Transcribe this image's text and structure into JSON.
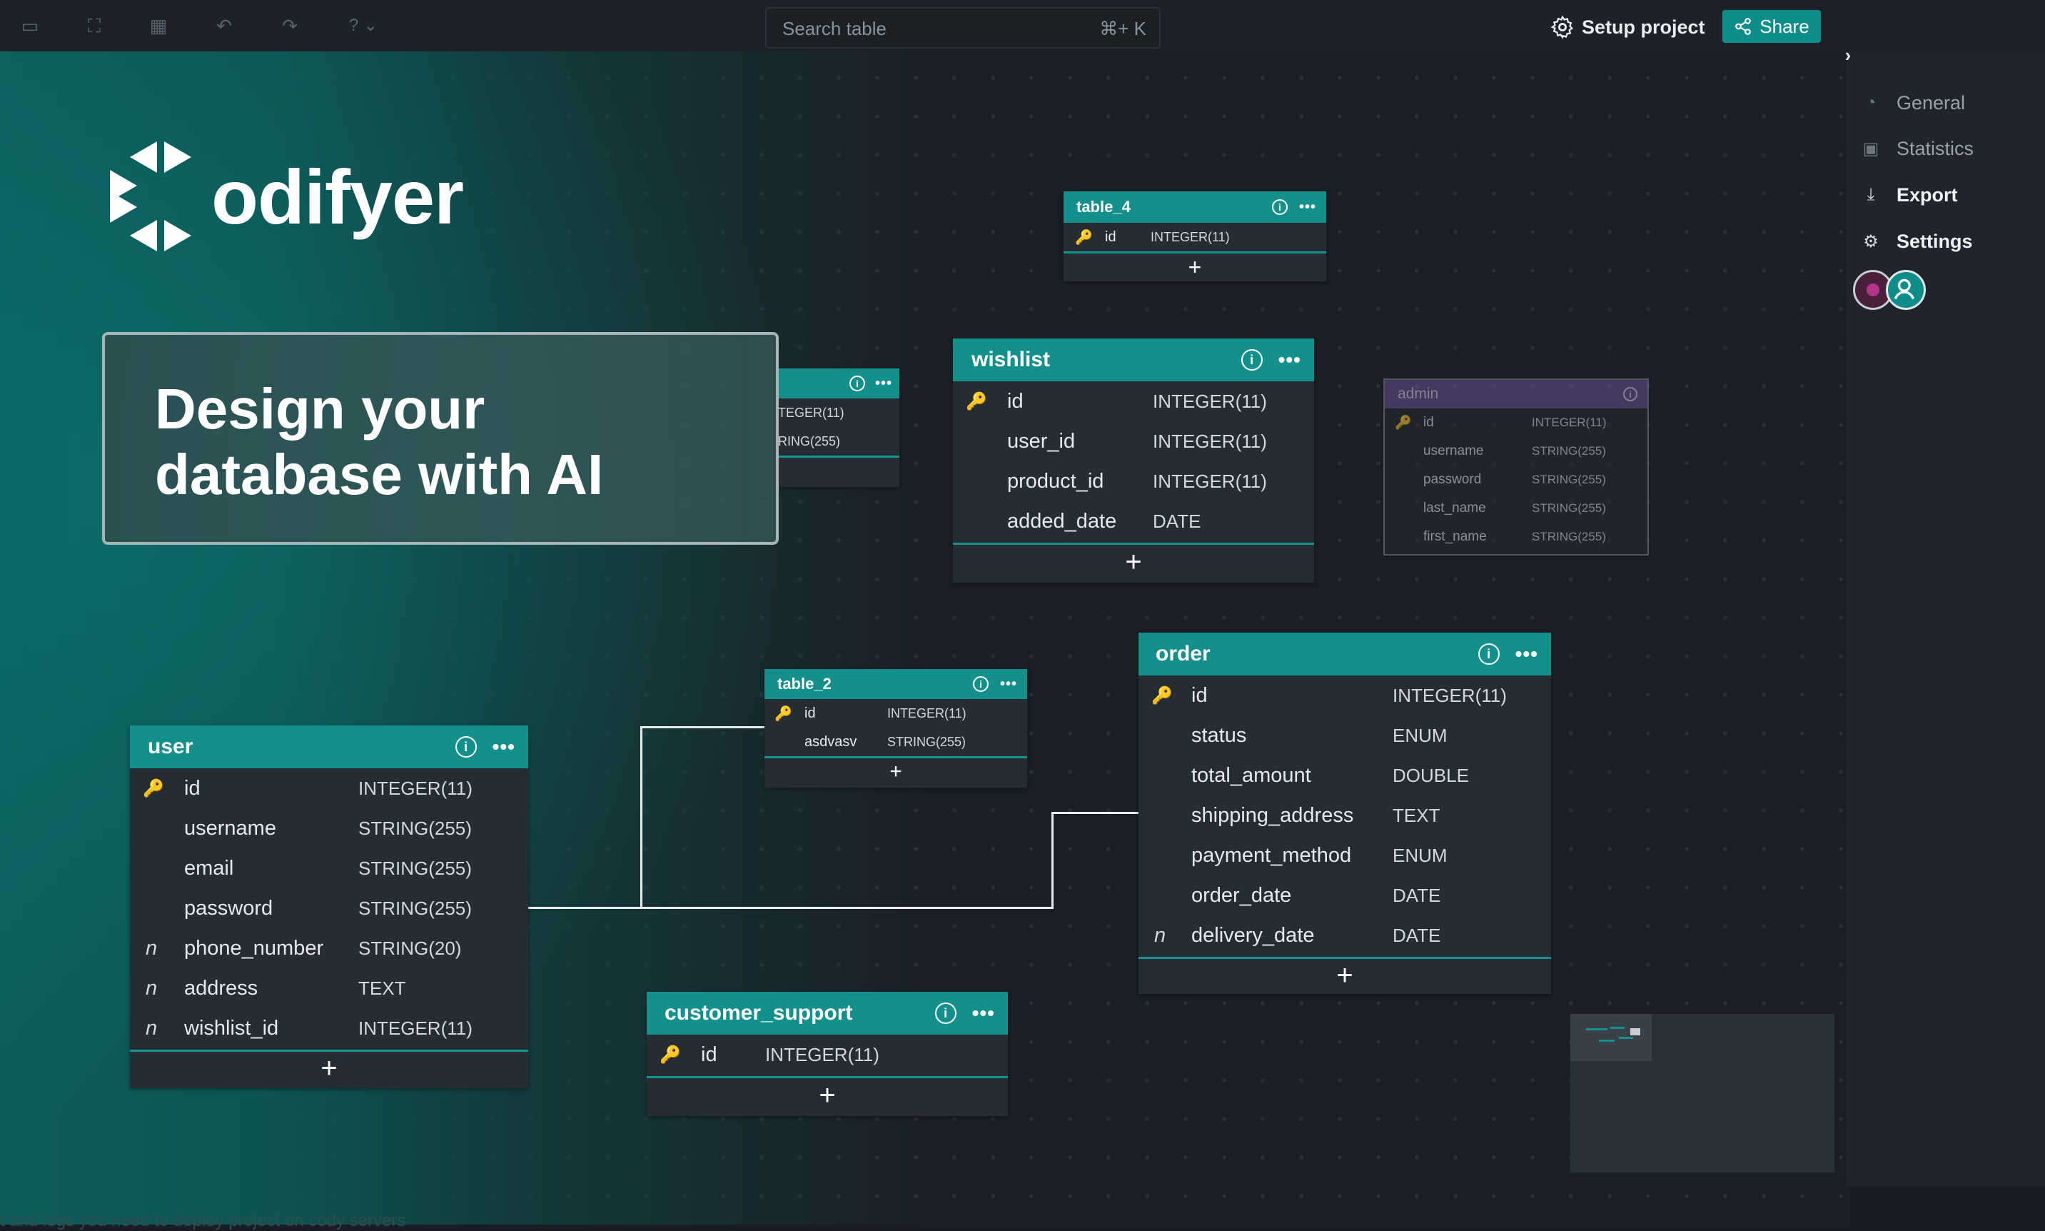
{
  "toolbar": {
    "search_placeholder": "Search table",
    "search_shortcut": "⌘+ K",
    "help_label": "?",
    "setup_label": "Setup project",
    "share_label": "Share"
  },
  "sidebar": {
    "items": [
      {
        "label": "General",
        "icon": "gauge-icon"
      },
      {
        "label": "Statistics",
        "icon": "chart-icon"
      },
      {
        "label": "Export",
        "icon": "download-icon"
      },
      {
        "label": "Settings",
        "icon": "gear-icon"
      }
    ]
  },
  "brand": {
    "logo_text": "odifyer"
  },
  "hero": {
    "line1": "Design your",
    "line2": "database with AI"
  },
  "tables": {
    "table_4": {
      "name": "table_4",
      "cols": [
        {
          "name": "id",
          "type": "INTEGER(11)"
        }
      ]
    },
    "partial": {
      "cols": [
        {
          "type": "TEGER(11)"
        },
        {
          "type": "RING(255)"
        }
      ]
    },
    "wishlist": {
      "name": "wishlist",
      "cols": [
        {
          "name": "id",
          "type": "INTEGER(11)"
        },
        {
          "name": "user_id",
          "type": "INTEGER(11)"
        },
        {
          "name": "product_id",
          "type": "INTEGER(11)"
        },
        {
          "name": "added_date",
          "type": "DATE"
        }
      ]
    },
    "admin": {
      "name": "admin",
      "cols": [
        {
          "name": "id",
          "type": "INTEGER(11)"
        },
        {
          "name": "username",
          "type": "STRING(255)"
        },
        {
          "name": "password",
          "type": "STRING(255)"
        },
        {
          "name": "last_name",
          "type": "STRING(255)"
        },
        {
          "name": "first_name",
          "type": "STRING(255)"
        }
      ]
    },
    "table_2": {
      "name": "table_2",
      "cols": [
        {
          "name": "id",
          "type": "INTEGER(11)"
        },
        {
          "name": "asdvasv",
          "type": "STRING(255)"
        }
      ]
    },
    "order": {
      "name": "order",
      "cols": [
        {
          "name": "id",
          "type": "INTEGER(11)"
        },
        {
          "name": "status",
          "type": "ENUM"
        },
        {
          "name": "total_amount",
          "type": "DOUBLE"
        },
        {
          "name": "shipping_address",
          "type": "TEXT"
        },
        {
          "name": "payment_method",
          "type": "ENUM"
        },
        {
          "name": "order_date",
          "type": "DATE"
        },
        {
          "name": "delivery_date",
          "type": "DATE"
        }
      ]
    },
    "user": {
      "name": "user",
      "cols": [
        {
          "name": "id",
          "type": "INTEGER(11)"
        },
        {
          "name": "username",
          "type": "STRING(255)"
        },
        {
          "name": "email",
          "type": "STRING(255)"
        },
        {
          "name": "password",
          "type": "STRING(255)"
        },
        {
          "name": "phone_number",
          "type": "STRING(20)"
        },
        {
          "name": "address",
          "type": "TEXT"
        },
        {
          "name": "wishlist_id",
          "type": "INTEGER(11)"
        }
      ]
    },
    "customer_support": {
      "name": "customer_support",
      "cols": [
        {
          "name": "id",
          "type": "INTEGER(11)"
        }
      ]
    }
  },
  "markers": {
    "nullable": "n",
    "add": "+",
    "dots": "•••",
    "info": "i"
  },
  "footer_text": "t and logs you need to deploy project on cody servers",
  "colors": {
    "accent": "#14908c",
    "share": "#0f8d8a",
    "key": "#e7c04a",
    "admin_head": "#6a4f8f"
  }
}
